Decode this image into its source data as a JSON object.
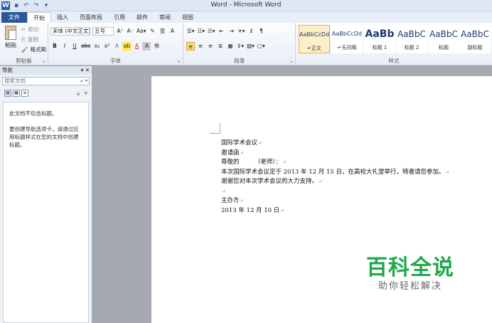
{
  "window": {
    "title": "Word - Microsoft Word"
  },
  "qat": {
    "logo": "W",
    "icons": [
      "save-icon",
      "undo-icon",
      "redo-icon",
      "customize-icon"
    ]
  },
  "tabs": [
    {
      "label": "文件"
    },
    {
      "label": "开始"
    },
    {
      "label": "插入"
    },
    {
      "label": "页面布局"
    },
    {
      "label": "引用"
    },
    {
      "label": "邮件"
    },
    {
      "label": "审阅"
    },
    {
      "label": "视图"
    }
  ],
  "ribbon": {
    "clipboard": {
      "paste": "粘贴",
      "cut": "剪切",
      "copy": "复制",
      "format_painter": "格式刷",
      "label": "剪贴板"
    },
    "font": {
      "font_name": "宋体 (中文正文)",
      "font_size": "五号",
      "label": "字体",
      "row1": [
        "A⁺",
        "A⁻",
        "Aa▾",
        "✎",
        "变",
        "A"
      ],
      "row2": [
        "B",
        "I",
        "U",
        "abc",
        "x₂",
        "x²",
        "A",
        "ab",
        "A",
        "A",
        "㊕"
      ]
    },
    "paragraph": {
      "label": "段落",
      "row1": [
        "☰▾",
        "☷▾",
        "☵▾",
        "⇤",
        "⇥",
        "✕▾",
        "↕",
        "¶"
      ],
      "row2": [
        "≡",
        "≡",
        "≡",
        "≣",
        "▦",
        "↕▾",
        "▨▾",
        "▢▾"
      ]
    },
    "styles": {
      "label": "样式",
      "items": [
        {
          "sample": "AaBbCcDd",
          "name": "↵正文"
        },
        {
          "sample": "AaBbCcDd",
          "name": "↵无间隔"
        },
        {
          "sample": "AaBb",
          "name": "标题 1"
        },
        {
          "sample": "AaBbC",
          "name": "标题 2"
        },
        {
          "sample": "AaBbC",
          "name": "标题"
        },
        {
          "sample": "AaBbC",
          "name": "副标题"
        }
      ]
    }
  },
  "nav": {
    "title": "导航",
    "search_placeholder": "搜索文档",
    "message1": "此文档不包含标题。",
    "message2": "要创建导航选项卡，请通过应用标题样式在您的文档中创建标题。"
  },
  "document": {
    "lines": [
      "国际学术会议",
      "邀请函",
      "尊敬的　　　（老师）：",
      "本次国际学术会议定于 2013 年 12 月 15 日，在高校大礼堂举行，特邀请您参加。",
      "谢谢您对本次学术会议的大力支持。",
      "",
      "主办方",
      "2013 年 12 月 10 日"
    ],
    "paragraph_mark": "↵"
  },
  "watermark": {
    "title": "百科全说",
    "subtitle": "助你轻松解决"
  }
}
